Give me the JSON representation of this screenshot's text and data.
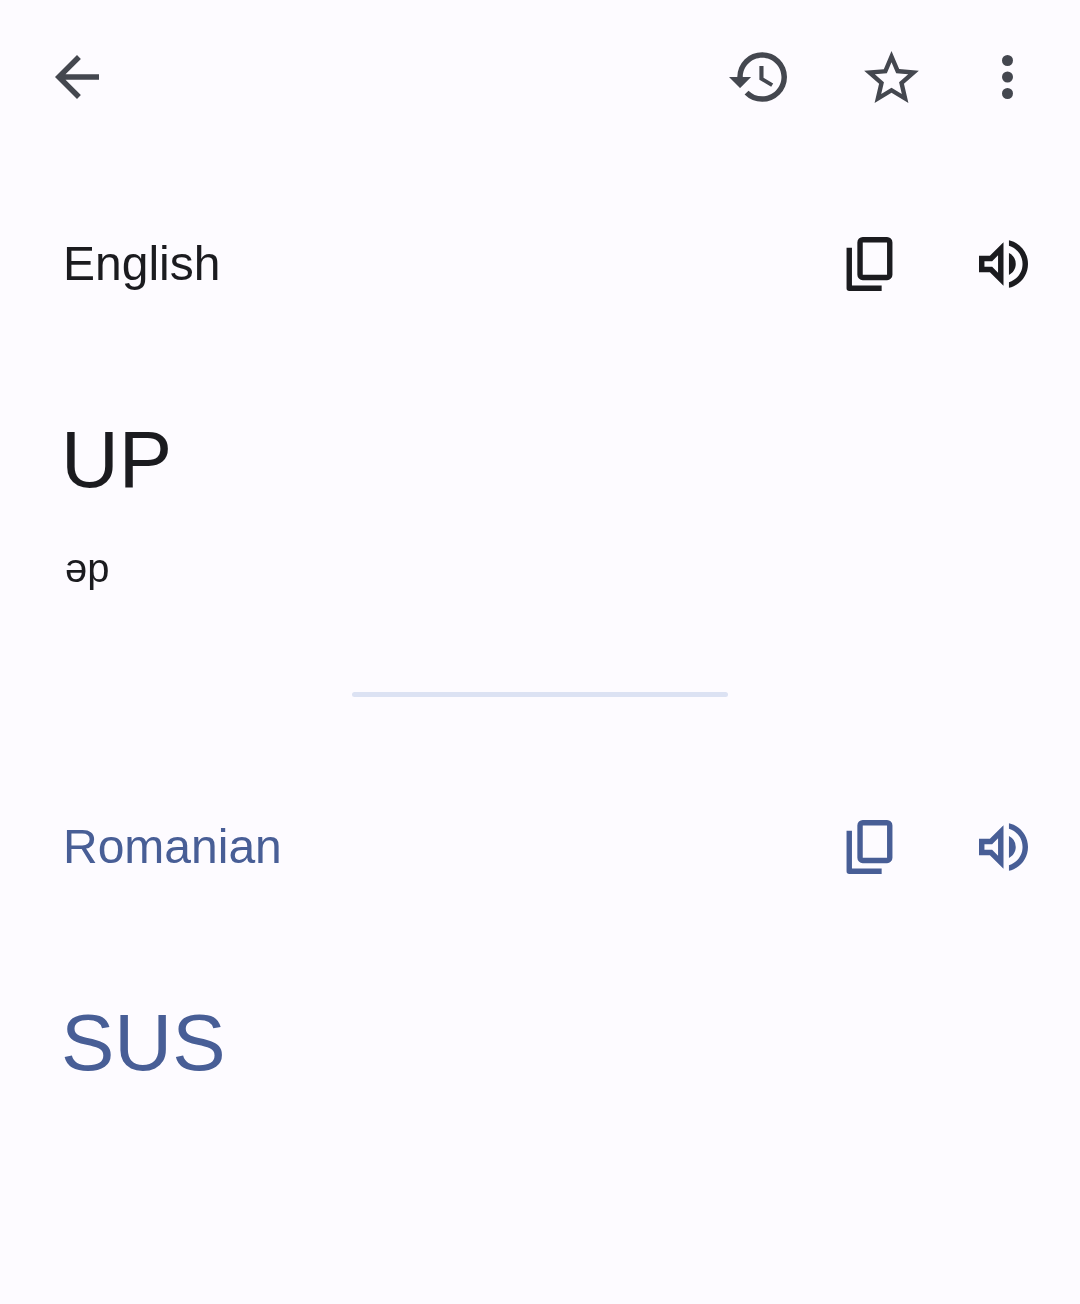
{
  "top_bar": {
    "actions": [
      {
        "kind": "back"
      },
      {
        "kind": "history"
      },
      {
        "kind": "star",
        "on": false
      },
      {
        "kind": "more"
      }
    ]
  },
  "panels": [
    {
      "kind": "source",
      "language": "English",
      "text": "UP",
      "transliteration": "əp"
    },
    {
      "kind": "target",
      "language": "Romanian",
      "text": "SUS"
    }
  ]
}
